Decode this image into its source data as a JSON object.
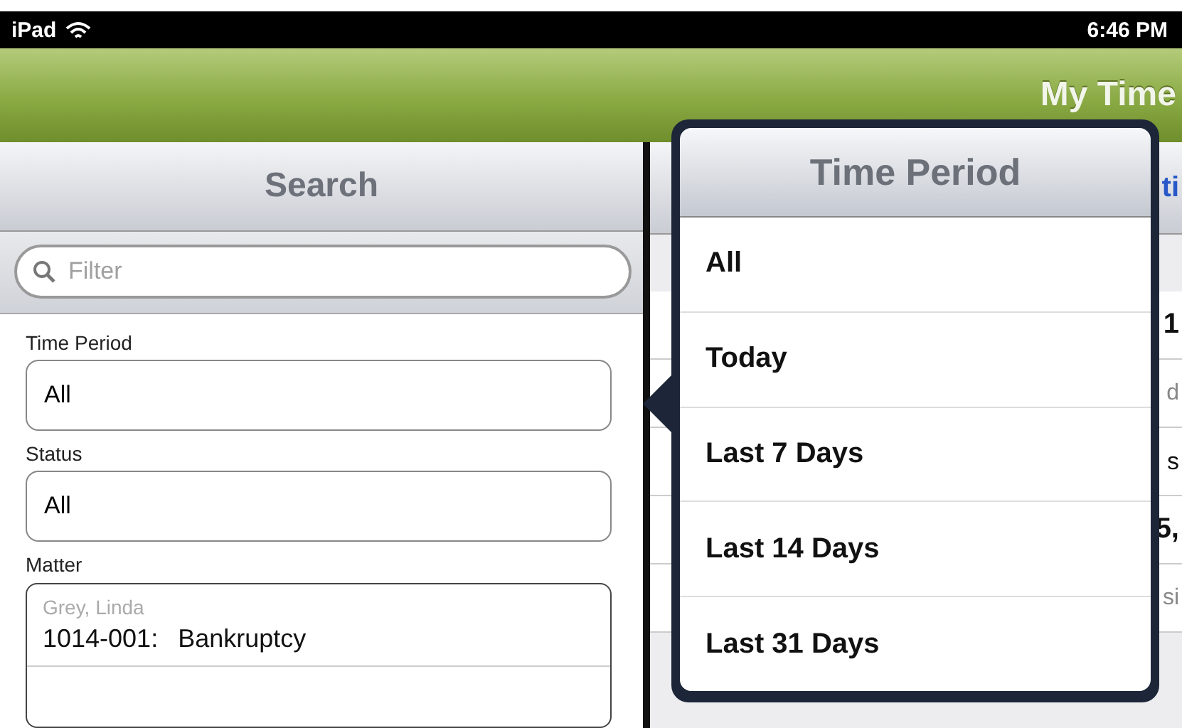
{
  "status_bar": {
    "device": "iPad",
    "time": "6:46 PM"
  },
  "nav_bar": {
    "title": "My Time"
  },
  "search_panel": {
    "title": "Search",
    "filter": {
      "placeholder": "Filter"
    },
    "fields": [
      {
        "label": "Time Period",
        "value": "All"
      },
      {
        "label": "Status",
        "value": "All"
      }
    ],
    "matter": {
      "label": "Matter",
      "items": [
        {
          "client": "Grey, Linda",
          "number": "1014-001:",
          "name": "Bankruptcy"
        }
      ]
    }
  },
  "detail_panel": {
    "tab": "ti",
    "rows": [
      {
        "kind": "bold",
        "text": "1"
      },
      {
        "kind": "sub",
        "text": "d"
      },
      {
        "kind": "plain",
        "text": "s"
      },
      {
        "kind": "bold",
        "text": "5,"
      },
      {
        "kind": "sub",
        "text": "si"
      }
    ]
  },
  "popover": {
    "title": "Time Period",
    "options": [
      {
        "label": "All"
      },
      {
        "label": "Today"
      },
      {
        "label": "Last 7 Days"
      },
      {
        "label": "Last 14 Days"
      },
      {
        "label": "Last 31 Days"
      }
    ]
  }
}
